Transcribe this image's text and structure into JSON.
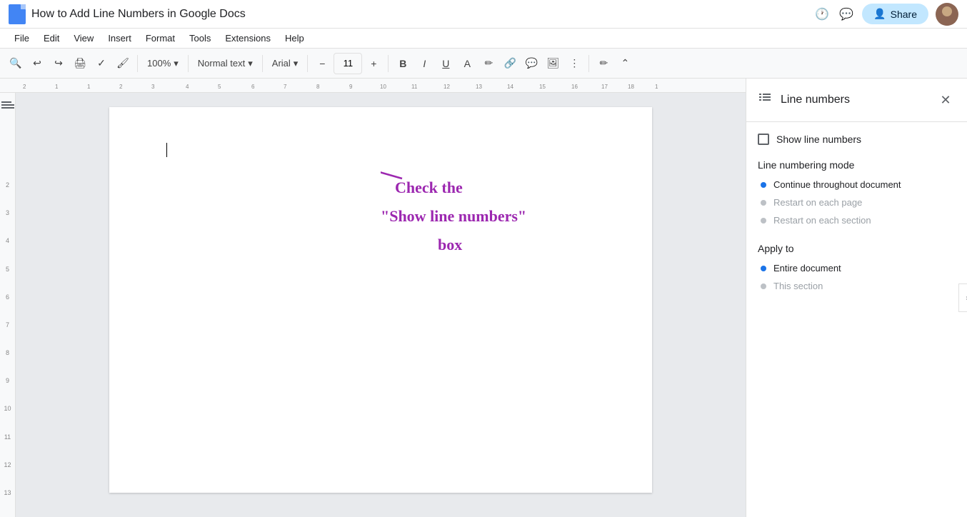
{
  "titlebar": {
    "title": "How to Add Line Numbers in Google Docs",
    "share_label": "Share"
  },
  "menubar": {
    "items": [
      "File",
      "Edit",
      "View",
      "Insert",
      "Format",
      "Tools",
      "Extensions",
      "Help"
    ]
  },
  "toolbar": {
    "zoom": "100%",
    "paragraph_style": "Normal text",
    "font": "Arial",
    "font_size": "11",
    "bold": "B",
    "italic": "I",
    "underline": "U"
  },
  "ruler": {
    "numbers": [
      "2",
      "3",
      "4",
      "5",
      "6",
      "7",
      "8",
      "9",
      "10",
      "11",
      "12",
      "13"
    ]
  },
  "panel": {
    "title": "Line numbers",
    "show_line_numbers_label": "Show line numbers",
    "numbering_mode_title": "Line numbering mode",
    "modes": [
      {
        "label": "Continue throughout document",
        "active": true
      },
      {
        "label": "Restart on each page",
        "active": false
      },
      {
        "label": "Restart on each section",
        "active": false
      }
    ],
    "apply_to_title": "Apply to",
    "apply_options": [
      {
        "label": "Entire document",
        "active": true
      },
      {
        "label": "This section",
        "active": false
      }
    ]
  },
  "annotation": {
    "line1": "Check the",
    "line2": "“Show line numbers”",
    "line3": "box"
  }
}
